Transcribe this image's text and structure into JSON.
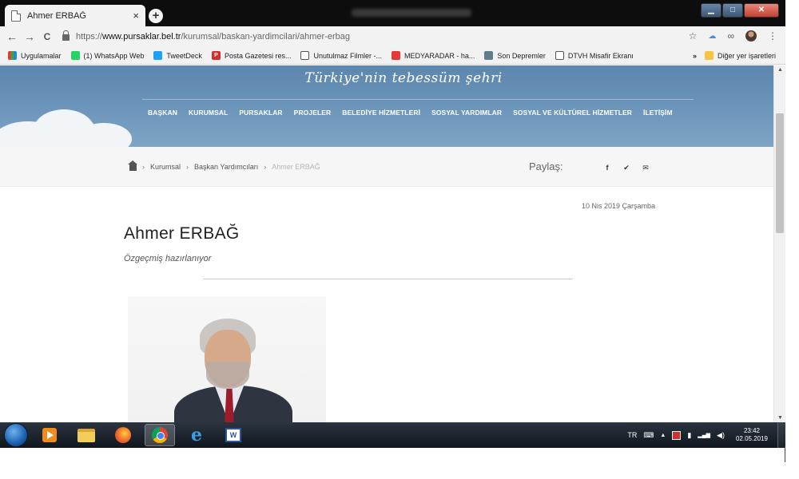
{
  "browser": {
    "tab_title": "Ahmer ERBAĞ",
    "tab_close": "×",
    "new_tab": "+",
    "win_min": "▁",
    "win_max": "□",
    "win_close": "✕",
    "url": {
      "scheme": "https://",
      "host": "www.pursaklar.bel.tr",
      "path": "/kurumsal/baskan-yardimcilari/ahmer-erbag"
    },
    "toolbar_icons": [
      "back-icon",
      "forward-icon",
      "reload-icon",
      "lock-icon",
      "star-icon",
      "cloud-icon",
      "infinity-icon",
      "avatar",
      "menu-icon"
    ],
    "nav": {
      "back": "←",
      "forward": "→",
      "reload": "C"
    },
    "right_glyphs": {
      "star": "☆",
      "cloud": "☁",
      "loop": "∞",
      "menu": "⋮"
    }
  },
  "bookmarks": {
    "items": [
      {
        "label": "Uygulamalar",
        "icon": "apps-icon"
      },
      {
        "label": "(1) WhatsApp Web",
        "icon": "whatsapp-icon"
      },
      {
        "label": "TweetDeck",
        "icon": "tweetdeck-icon"
      },
      {
        "label": "Posta Gazetesi res...",
        "icon": "posta-icon"
      },
      {
        "label": "Unutulmaz Filmler -...",
        "icon": "page-icon"
      },
      {
        "label": "MEDYARADAR - ha...",
        "icon": "medyaradar-icon"
      },
      {
        "label": "Son Depremler",
        "icon": "deprem-icon"
      },
      {
        "label": "DTVH Misafir Ekranı",
        "icon": "page-icon"
      }
    ],
    "more": "»",
    "other": "Diğer yer işaretleri"
  },
  "site": {
    "slogan": "Türkiye'nin tebessüm şehri",
    "nav": [
      "BAŞKAN",
      "KURUMSAL",
      "PURSAKLAR",
      "PROJELER",
      "BELEDİYE HİZMETLERİ",
      "SOSYAL YARDIMLAR",
      "SOSYAL VE KÜLTÜREL HİZMETLER",
      "İLETİŞİM"
    ],
    "breadcrumb": {
      "items": [
        "Kurumsal",
        "Başkan Yardımcıları"
      ],
      "current": "Ahmer ERBAĞ",
      "separator": "›"
    },
    "share": {
      "label": "Paylaş:",
      "facebook": "f",
      "twitter": "✔",
      "email": "✉"
    },
    "article": {
      "date": "10 Nis 2019 Çarşamba",
      "name": "Ahmer ERBAĞ",
      "bio": "Özgeçmiş hazırlanıyor"
    }
  },
  "scrollbar": {
    "up": "▲",
    "down": "▼"
  },
  "taskbar": {
    "apps": [
      "media-player",
      "file-explorer",
      "firefox",
      "chrome",
      "internet-explorer",
      "word"
    ],
    "ie_glyph": "e",
    "word_glyph": "W",
    "tray": {
      "language": "TR",
      "show_hidden": "▲",
      "keyboard": "⌨",
      "battery": "▮",
      "signal": "▂▄▆",
      "volume": "◀)"
    },
    "clock": {
      "time": "23:42",
      "date": "02.05.2019"
    }
  },
  "colors": {
    "banner": "#6a93b9",
    "taskbar": "#1a222b",
    "chrome_frame": "#0d0d0d",
    "toolbar": "#f2f2f2"
  }
}
